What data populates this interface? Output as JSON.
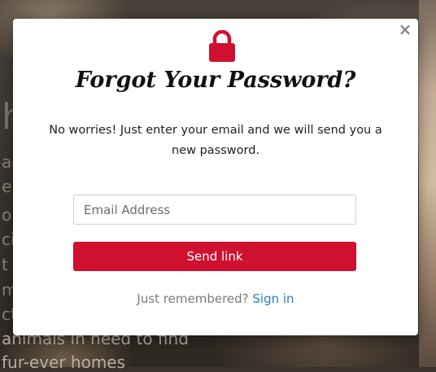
{
  "background": {
    "heading_fragment": "h",
    "text_fragments": [
      "ar",
      "e",
      "olu",
      "ci",
      "t a",
      "mb",
      "ct",
      "animals in need to find",
      "fur-ever homes"
    ]
  },
  "modal": {
    "close_label": "×",
    "icon": "lock-icon",
    "title": "Forgot Your Password?",
    "description": "No worries! Just enter your email and we will send you a new password.",
    "email_input": {
      "placeholder": "Email Address",
      "value": ""
    },
    "send_button_label": "Send link",
    "footer_text": "Just remembered?",
    "footer_link_label": "Sign in"
  },
  "colors": {
    "accent_red": "#d0102f",
    "link_blue": "#2a7fc8"
  }
}
